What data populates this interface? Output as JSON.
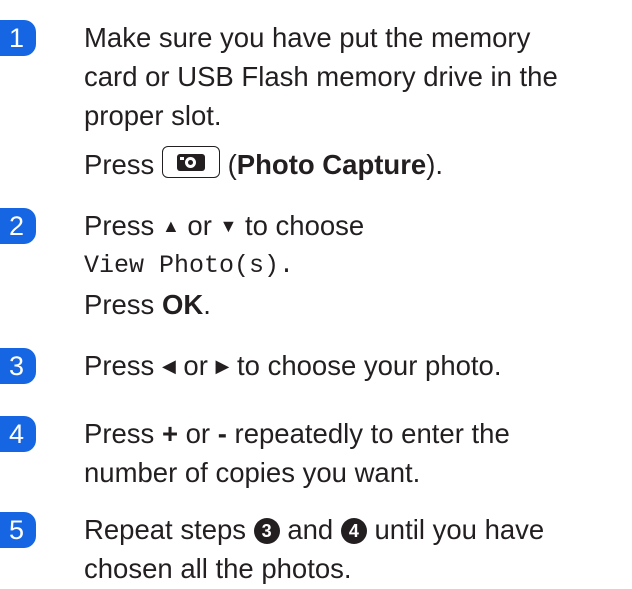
{
  "steps": [
    {
      "number": "1",
      "line1": "Make sure you have put the memory",
      "line2": "card or USB Flash memory drive in the",
      "line3": "proper slot.",
      "press": "Press",
      "open_paren": "(",
      "button_name": "Photo Capture",
      "close": ")."
    },
    {
      "number": "2",
      "press": "Press",
      "up": "▲",
      "or": "or",
      "down": "▼",
      "to_choose": "to choose",
      "menu_item": "View Photo(s).",
      "press2": "Press",
      "ok": "OK",
      "period": "."
    },
    {
      "number": "3",
      "press": "Press",
      "left": "◀",
      "or": "or",
      "right": "▶",
      "rest": "to choose your photo."
    },
    {
      "number": "4",
      "press": "Press",
      "plus": "+",
      "or": "or",
      "minus": "-",
      "rest1": "repeatedly to enter the",
      "line2": "number of copies you want."
    },
    {
      "number": "5",
      "text1": "Repeat steps",
      "ref1": "3",
      "and": "and",
      "ref2": "4",
      "text2": "until you have",
      "line2": "chosen all the photos."
    }
  ],
  "icons": {
    "photo_capture": "camera-icon"
  },
  "colors": {
    "accent": "#1666e3"
  }
}
